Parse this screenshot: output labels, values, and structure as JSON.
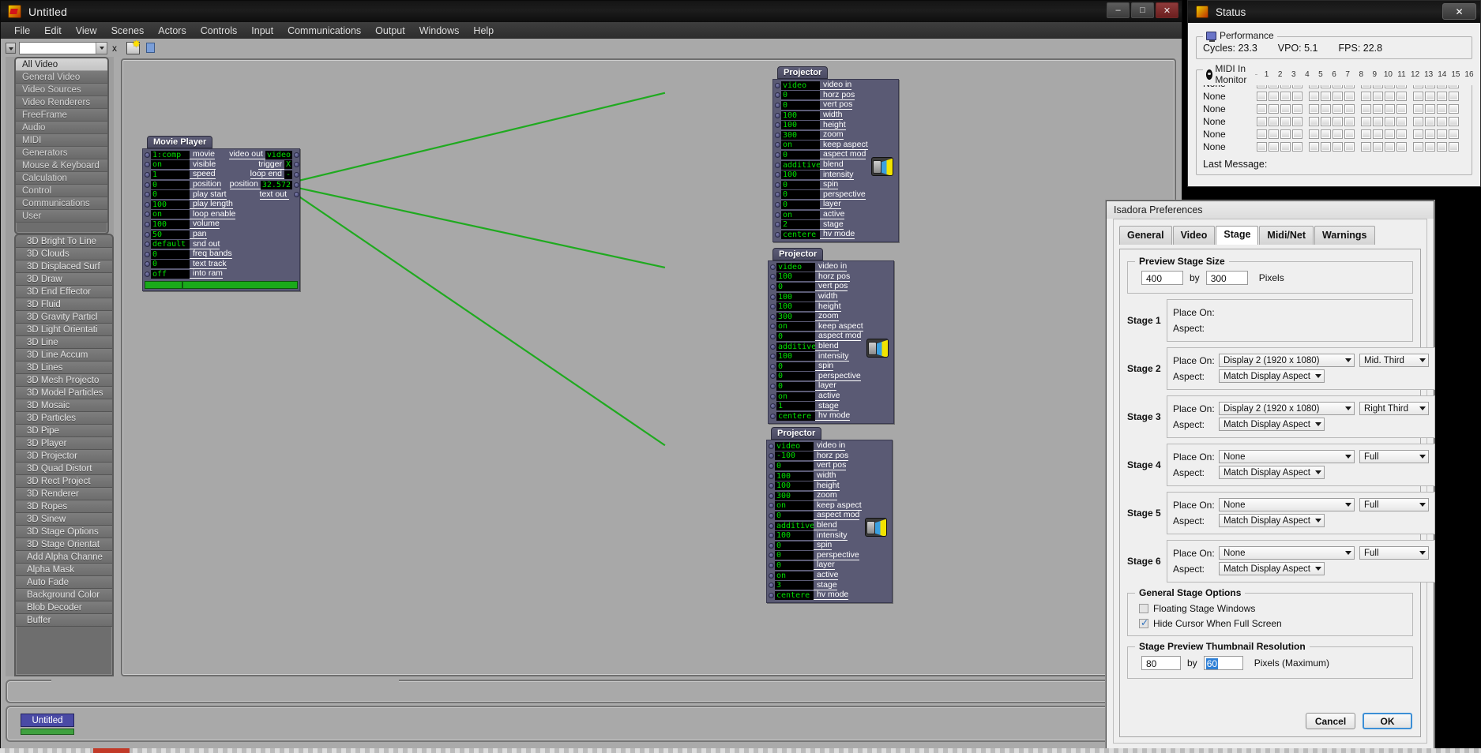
{
  "window": {
    "title": "Untitled",
    "minimize": "–",
    "maximize": "□",
    "close": "✕"
  },
  "menu": [
    "File",
    "Edit",
    "View",
    "Scenes",
    "Actors",
    "Controls",
    "Input",
    "Communications",
    "Output",
    "Windows",
    "Help"
  ],
  "toolbar": {
    "scene_field_value": "",
    "close_label": "x"
  },
  "categories": [
    {
      "label": "All Video",
      "selected": true
    },
    {
      "label": "General Video",
      "selected": false
    },
    {
      "label": "Video Sources",
      "selected": false
    },
    {
      "label": "Video Renderers",
      "selected": false
    },
    {
      "label": "FreeFrame",
      "selected": false
    },
    {
      "label": "Audio",
      "selected": false
    },
    {
      "label": "MIDI",
      "selected": false
    },
    {
      "label": "Generators",
      "selected": false
    },
    {
      "label": "Mouse & Keyboard",
      "selected": false
    },
    {
      "label": "Calculation",
      "selected": false
    },
    {
      "label": "Control",
      "selected": false
    },
    {
      "label": "Communications",
      "selected": false
    },
    {
      "label": "User",
      "selected": false
    }
  ],
  "actors": [
    "3D Bright To Line",
    "3D Clouds",
    "3D Displaced Surf",
    "3D Draw",
    "3D End Effector",
    "3D Fluid",
    "3D Gravity Particl",
    "3D Light Orientati",
    "3D Line",
    "3D Line Accum",
    "3D Lines",
    "3D Mesh Projecto",
    "3D Model Particles",
    "3D Mosaic",
    "3D Particles",
    "3D Pipe",
    "3D Player",
    "3D Projector",
    "3D Quad Distort",
    "3D Rect Project",
    "3D Renderer",
    "3D Ropes",
    "3D Sinew",
    "3D Stage Options",
    "3D Stage Orientat",
    "Add Alpha Channe",
    "Alpha Mask",
    "Auto Fade",
    "Background Color",
    "Blob Decoder",
    "Buffer"
  ],
  "nodes": {
    "movie_player": {
      "title": "Movie Player",
      "inputs": [
        {
          "value": "1:comp",
          "label": "movie"
        },
        {
          "value": "on",
          "label": "visible"
        },
        {
          "value": "1",
          "label": "speed"
        },
        {
          "value": "0",
          "label": "position"
        },
        {
          "value": "0",
          "label": "play start"
        },
        {
          "value": "100",
          "label": "play length"
        },
        {
          "value": "on",
          "label": "loop enable"
        },
        {
          "value": "100",
          "label": "volume"
        },
        {
          "value": "50",
          "label": "pan"
        },
        {
          "value": "default",
          "label": "snd out"
        },
        {
          "value": "0",
          "label": "freq bands"
        },
        {
          "value": "0",
          "label": "text track"
        },
        {
          "value": "off",
          "label": "into ram"
        }
      ],
      "outputs": [
        {
          "label": "video out",
          "value": "video"
        },
        {
          "label": "trigger",
          "value": "X"
        },
        {
          "label": "loop end",
          "value": "-"
        },
        {
          "label": "position",
          "value": "32.572"
        },
        {
          "label": "text out",
          "value": ""
        }
      ]
    },
    "projectors": [
      {
        "title": "Projector",
        "inputs": [
          {
            "value": "video",
            "label": "video in"
          },
          {
            "value": "0",
            "label": "horz pos"
          },
          {
            "value": "0",
            "label": "vert pos"
          },
          {
            "value": "100",
            "label": "width"
          },
          {
            "value": "100",
            "label": "height"
          },
          {
            "value": "300",
            "label": "zoom"
          },
          {
            "value": "on",
            "label": "keep aspect"
          },
          {
            "value": "0",
            "label": "aspect mod"
          },
          {
            "value": "additive",
            "label": "blend"
          },
          {
            "value": "100",
            "label": "intensity"
          },
          {
            "value": "0",
            "label": "spin"
          },
          {
            "value": "0",
            "label": "perspective"
          },
          {
            "value": "0",
            "label": "layer"
          },
          {
            "value": "on",
            "label": "active"
          },
          {
            "value": "2",
            "label": "stage"
          },
          {
            "value": "centere",
            "label": "hv mode"
          }
        ]
      },
      {
        "title": "Projector",
        "inputs": [
          {
            "value": "video",
            "label": "video in"
          },
          {
            "value": "100",
            "label": "horz pos"
          },
          {
            "value": "0",
            "label": "vert pos"
          },
          {
            "value": "100",
            "label": "width"
          },
          {
            "value": "100",
            "label": "height"
          },
          {
            "value": "300",
            "label": "zoom"
          },
          {
            "value": "on",
            "label": "keep aspect"
          },
          {
            "value": "0",
            "label": "aspect mod"
          },
          {
            "value": "additive",
            "label": "blend"
          },
          {
            "value": "100",
            "label": "intensity"
          },
          {
            "value": "0",
            "label": "spin"
          },
          {
            "value": "0",
            "label": "perspective"
          },
          {
            "value": "0",
            "label": "layer"
          },
          {
            "value": "on",
            "label": "active"
          },
          {
            "value": "1",
            "label": "stage"
          },
          {
            "value": "centere",
            "label": "hv mode"
          }
        ]
      },
      {
        "title": "Projector",
        "inputs": [
          {
            "value": "video",
            "label": "video in"
          },
          {
            "value": "-100",
            "label": "horz pos"
          },
          {
            "value": "0",
            "label": "vert pos"
          },
          {
            "value": "100",
            "label": "width"
          },
          {
            "value": "100",
            "label": "height"
          },
          {
            "value": "300",
            "label": "zoom"
          },
          {
            "value": "on",
            "label": "keep aspect"
          },
          {
            "value": "0",
            "label": "aspect mod"
          },
          {
            "value": "additive",
            "label": "blend"
          },
          {
            "value": "100",
            "label": "intensity"
          },
          {
            "value": "0",
            "label": "spin"
          },
          {
            "value": "0",
            "label": "perspective"
          },
          {
            "value": "0",
            "label": "layer"
          },
          {
            "value": "on",
            "label": "active"
          },
          {
            "value": "3",
            "label": "stage"
          },
          {
            "value": "centere",
            "label": "hv mode"
          }
        ]
      }
    ]
  },
  "scene_strip": {
    "tab_label": "Untitled"
  },
  "status": {
    "title": "Status",
    "close": "✕",
    "performance": {
      "caption": "Performance",
      "cycles": "Cycles: 23.3",
      "vpo": "VPO: 5.1",
      "fps": "FPS: 22.8"
    },
    "midi": {
      "caption": "MIDI In Monitor",
      "channels": [
        "1",
        "2",
        "3",
        "4",
        "5",
        "6",
        "7",
        "8",
        "9",
        "10",
        "11",
        "12",
        "13",
        "14",
        "15",
        "16"
      ],
      "rows": [
        "None",
        "None",
        "None",
        "None",
        "None",
        "None"
      ],
      "last_message": "Last Message:"
    }
  },
  "prefs": {
    "title": "Isadora Preferences",
    "tabs": [
      {
        "label": "General",
        "active": false
      },
      {
        "label": "Video",
        "active": false
      },
      {
        "label": "Stage",
        "active": true
      },
      {
        "label": "Midi/Net",
        "active": false
      },
      {
        "label": "Warnings",
        "active": false
      }
    ],
    "preview_stage_size": {
      "caption": "Preview Stage Size",
      "width": "400",
      "by": "by",
      "height": "300",
      "units": "Pixels"
    },
    "place_on_label": "Place On:",
    "aspect_label": "Aspect:",
    "stages": [
      {
        "name": "Stage 1",
        "display": "",
        "position": "",
        "aspect": "",
        "show_selects": false
      },
      {
        "name": "Stage 2",
        "display": "Display 2 (1920 x 1080)",
        "position": "Mid. Third",
        "aspect": "Match Display Aspect",
        "show_selects": true
      },
      {
        "name": "Stage 3",
        "display": "Display 2 (1920 x 1080)",
        "position": "Right Third",
        "aspect": "Match Display Aspect",
        "show_selects": true
      },
      {
        "name": "Stage 4",
        "display": "None",
        "position": "Full",
        "aspect": "Match Display Aspect",
        "show_selects": true
      },
      {
        "name": "Stage 5",
        "display": "None",
        "position": "Full",
        "aspect": "Match Display Aspect",
        "show_selects": true
      },
      {
        "name": "Stage 6",
        "display": "None",
        "position": "Full",
        "aspect": "Match Display Aspect",
        "show_selects": true
      }
    ],
    "general_stage_options": {
      "caption": "General Stage Options",
      "floating": {
        "label": "Floating Stage Windows",
        "checked": false
      },
      "hide_cursor": {
        "label": "Hide Cursor When Full Screen",
        "checked": true
      }
    },
    "thumbnail": {
      "caption": "Stage Preview Thumbnail Resolution",
      "width": "80",
      "by": "by",
      "height": "60",
      "units": "Pixels (Maximum)"
    },
    "buttons": {
      "cancel": "Cancel",
      "ok": "OK"
    }
  },
  "colors": {
    "wire": "#1faa1f",
    "node_body": "#5a5a74",
    "value_text": "#00e000",
    "accent_blue": "#2d7fd6"
  }
}
